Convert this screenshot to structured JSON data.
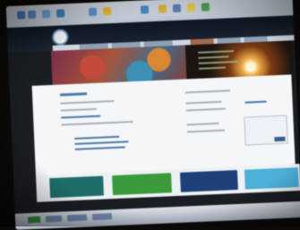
{
  "colors": {
    "site_header": "#1c2532",
    "content_bg": "#f4f6f8",
    "accent_blue": "#3a5f8c",
    "browser_chrome": "#c6ceda"
  },
  "banners": [
    {
      "color": "#1f6d68"
    },
    {
      "color": "#3a9a3c"
    },
    {
      "color": "#1d3f7a"
    },
    {
      "color": "#4bb0d8"
    }
  ]
}
